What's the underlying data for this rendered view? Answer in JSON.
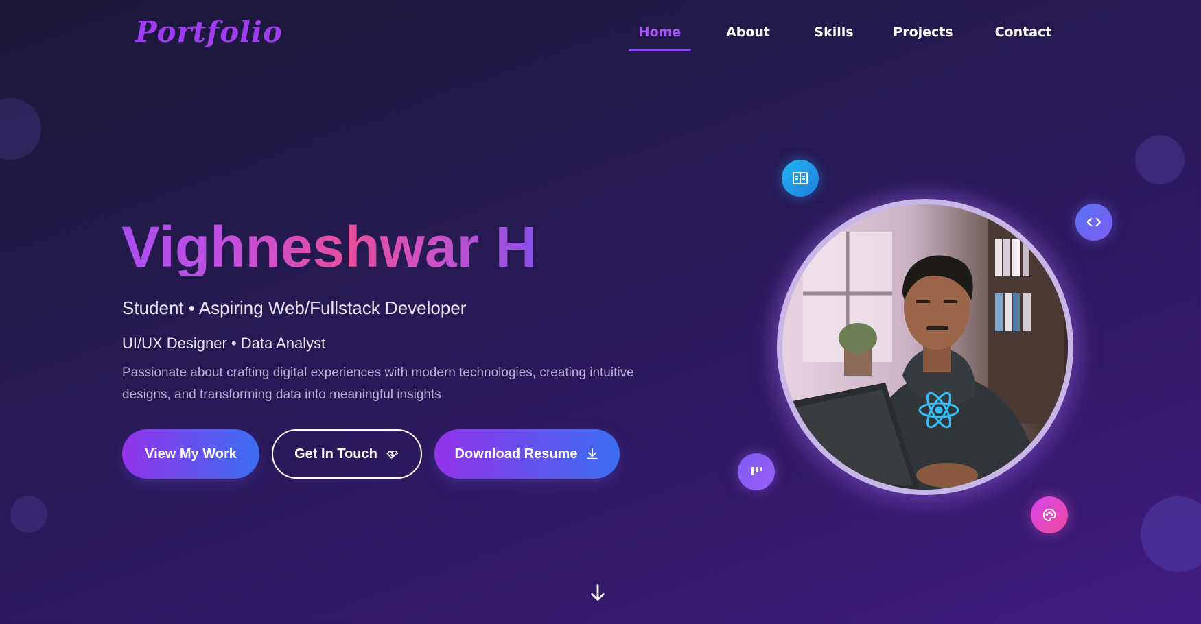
{
  "brand": {
    "logo_text": "Portfolio",
    "accent": "#a855f7"
  },
  "nav": {
    "items": [
      {
        "label": "Home",
        "active": true
      },
      {
        "label": "About",
        "active": false
      },
      {
        "label": "Skills",
        "active": false
      },
      {
        "label": "Projects",
        "active": false
      },
      {
        "label": "Contact",
        "active": false
      }
    ]
  },
  "hero": {
    "name": "Vighneshwar H",
    "subtitle": "Student • Aspiring Web/Fullstack Developer",
    "roles": "UI/UX Designer • Data Analyst",
    "description": "Passionate about crafting digital experiences with modern technologies, creating intuitive designs, and transforming data into meaningful insights",
    "buttons": {
      "view_work": "View My Work",
      "get_in_touch": "Get In Touch",
      "download_resume": "Download Resume"
    }
  },
  "icons": {
    "touch": "handshake-icon",
    "resume": "download-icon",
    "scroll": "arrow-down-icon",
    "bubbles": [
      "document-icon",
      "code-icon",
      "figma-icon",
      "palette-icon"
    ]
  },
  "colors": {
    "background_start": "#1b1838",
    "background_end": "#3f1c82",
    "button_gradient_start": "#9333ea",
    "button_gradient_end": "#3b6ef0"
  }
}
